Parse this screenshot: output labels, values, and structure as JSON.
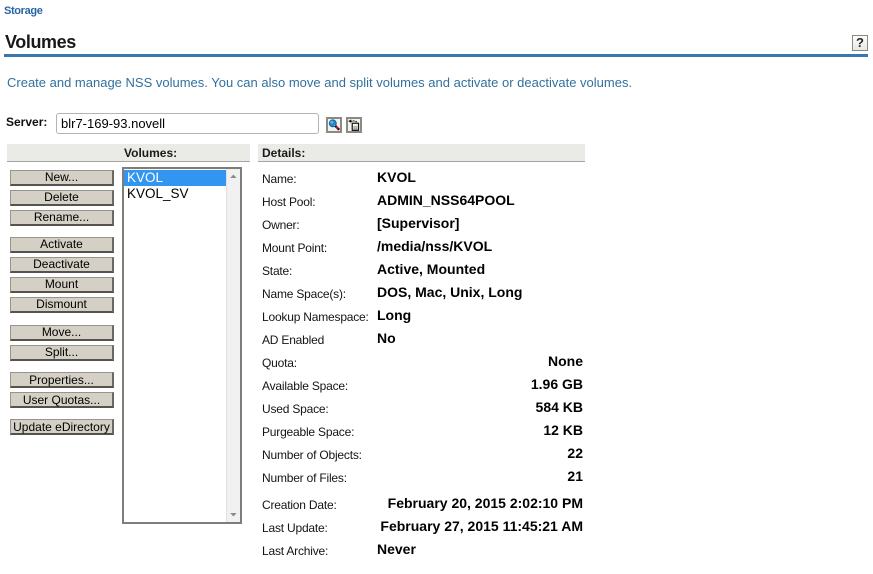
{
  "page": {
    "breadcrumb": "Storage",
    "title": "Volumes",
    "help_label": "?",
    "description": "Create and manage NSS volumes. You can also move and split volumes and activate or deactivate volumes."
  },
  "server": {
    "label": "Server:",
    "value": "blr7-169-93.novell",
    "selector_icon": "object-selector-magnifier",
    "history_icon": "object-history"
  },
  "panel": {
    "volumes_header": "Volumes:",
    "details_header": "Details:"
  },
  "actions": {
    "groups": [
      [
        "New...",
        "Delete",
        "Rename..."
      ],
      [
        "Activate",
        "Deactivate",
        "Mount",
        "Dismount"
      ],
      [
        "Move...",
        "Split..."
      ],
      [
        "Properties...",
        "User Quotas..."
      ],
      [
        "Update eDirectory"
      ]
    ]
  },
  "volumes": {
    "items": [
      {
        "name": "KVOL",
        "selected": true
      },
      {
        "name": "KVOL_SV",
        "selected": false
      }
    ]
  },
  "details": {
    "rows": [
      {
        "label": "Name:",
        "value": "KVOL",
        "align": "left"
      },
      {
        "label": "Host Pool:",
        "value": "ADMIN_NSS64POOL",
        "align": "left"
      },
      {
        "label": "Owner:",
        "value": "[Supervisor]",
        "align": "left"
      },
      {
        "label": "Mount Point:",
        "value": "/media/nss/KVOL",
        "align": "left"
      },
      {
        "label": "State:",
        "value": "Active, Mounted",
        "align": "left"
      },
      {
        "label": "Name Space(s):",
        "value": "DOS, Mac, Unix, Long",
        "align": "left"
      },
      {
        "label": "Lookup Namespace:",
        "value": "Long",
        "align": "left"
      },
      {
        "label": "AD Enabled",
        "value": "No",
        "align": "left"
      },
      {
        "label": "Quota:",
        "value": "None",
        "align": "right"
      },
      {
        "label": "Available Space:",
        "value": "1.96 GB",
        "align": "right"
      },
      {
        "label": "Used Space:",
        "value": "584 KB",
        "align": "right"
      },
      {
        "label": "Purgeable Space:",
        "value": "12 KB",
        "align": "right"
      },
      {
        "label": "Number of Objects:",
        "value": "22",
        "align": "right"
      },
      {
        "label": "Number of Files:",
        "value": "21",
        "align": "right"
      },
      {
        "label": "Creation Date:",
        "value": "February 20, 2015 2:02:10 PM",
        "align": "right"
      },
      {
        "label": "Last Update:",
        "value": "February 27, 2015 11:45:21 AM",
        "align": "right"
      },
      {
        "label": "Last Archive:",
        "value": "Never",
        "align": "left"
      }
    ]
  },
  "colors": {
    "accent_rule": "#3878ae",
    "link": "#2a6da4",
    "description": "#31719f",
    "selection": "#3296f0",
    "strip": "#eaeae6",
    "button_face": "#d5d1c8"
  }
}
